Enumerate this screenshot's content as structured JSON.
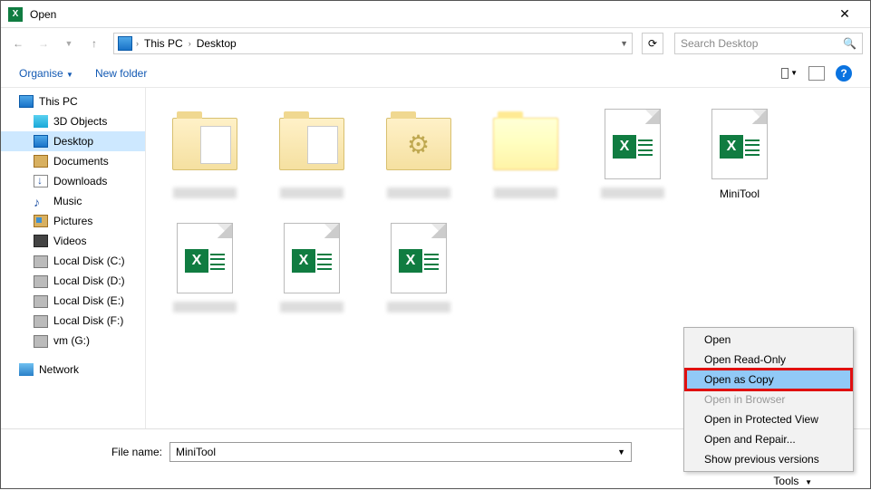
{
  "window": {
    "title": "Open"
  },
  "nav": {
    "path": [
      "This PC",
      "Desktop"
    ],
    "search_placeholder": "Search Desktop"
  },
  "toolbar": {
    "organise": "Organise",
    "new_folder": "New folder"
  },
  "tree": {
    "root": "This PC",
    "items": [
      "3D Objects",
      "Desktop",
      "Documents",
      "Downloads",
      "Music",
      "Pictures",
      "Videos",
      "Local Disk (C:)",
      "Local Disk (D:)",
      "Local Disk (E:)",
      "Local Disk (F:)",
      "vm (G:)"
    ],
    "network": "Network"
  },
  "files": [
    {
      "type": "folder",
      "variant": "doc",
      "label": ""
    },
    {
      "type": "folder",
      "variant": "doc",
      "label": ""
    },
    {
      "type": "folder",
      "variant": "gear",
      "label": ""
    },
    {
      "type": "folder",
      "variant": "pix",
      "label": ""
    },
    {
      "type": "excel",
      "label": ""
    },
    {
      "type": "excel",
      "label": "MiniTool"
    },
    {
      "type": "excel",
      "label": ""
    },
    {
      "type": "excel",
      "label": ""
    },
    {
      "type": "excel",
      "label": ""
    }
  ],
  "footer": {
    "filename_label": "File name:",
    "filename_value": "MiniTool",
    "tools": "Tools"
  },
  "context_menu": [
    {
      "label": "Open",
      "state": ""
    },
    {
      "label": "Open Read-Only",
      "state": ""
    },
    {
      "label": "Open as Copy",
      "state": "hl"
    },
    {
      "label": "Open in Browser",
      "state": "dis"
    },
    {
      "label": "Open in Protected View",
      "state": ""
    },
    {
      "label": "Open and Repair...",
      "state": ""
    },
    {
      "label": "Show previous versions",
      "state": ""
    }
  ]
}
